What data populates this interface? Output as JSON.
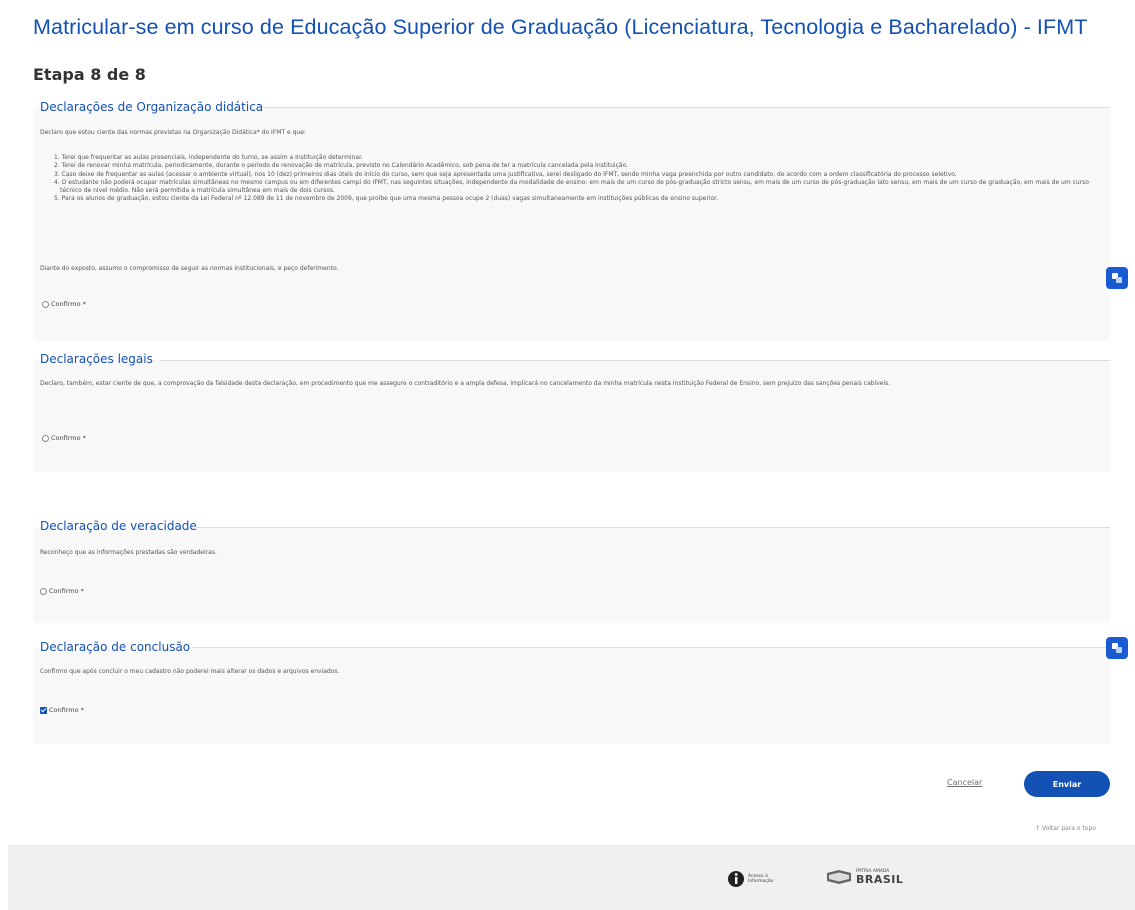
{
  "header": {
    "title": "Matricular-se em curso de Educação Superior de Graduação (Licenciatura, Tecnologia e Bacharelado) - IFMT",
    "step": "Etapa 8 de 8"
  },
  "sections": {
    "org": {
      "legend": "Declarações de Organização didática",
      "intro": "Declaro que estou ciente das normas previstas na Organização Didática* do IFMT e que:",
      "items": [
        "1. Terei que frequentar as aulas presenciais, independente do turno, se assim a Instituição determinar.",
        "2. Terei de renovar minha matrícula, periodicamente, durante o período de renovação de matrícula, previsto no Calendário Acadêmico, sob pena de ter a matrícula cancelada pela Instituição.",
        "3. Caso deixe de frequentar as aulas (acessar o ambiente virtual), nos 10 (dez) primeiros dias úteis do início do curso, sem que seja apresentada uma justificativa, serei desligado do IFMT, sendo minha vaga preenchida por outro candidato, de acordo com a ordem classificatória do processo seletivo.",
        "4. O estudante não poderá ocupar matrículas simultâneas no mesmo campus ou em diferentes campi do IFMT, nas seguintes situações, independente da modalidade de ensino: em mais de um curso de pós-graduação stricto sensu, em mais de um curso de pós-graduação lato sensu, em mais de um curso de graduação, em mais de um curso técnico de nível médio. Não será permitida a matrícula simultânea em mais de dois cursos.",
        "5. Para os alunos de graduação, estou ciente da Lei Federal nº 12.089 de 11 de novembro de 2009, que proíbe que uma mesma pessoa ocupe 2 (duas) vagas simultaneamente em instituições públicas de ensino superior."
      ],
      "closing": "Diante do exposto, assumo o compromisso de seguir as normas institucionais, e peço deferimento.",
      "confirm_label": "Confirmo *"
    },
    "legal": {
      "legend": "Declarações legais",
      "text": "Declaro, também, estar ciente de que, a comprovação da falsidade desta declaração, em procedimento que me assegure o contraditório e a ampla defesa, implicará no cancelamento da minha matrícula nesta Instituição Federal de Ensino, sem prejuízo das sanções penais cabíveis.",
      "confirm_label": "Confirmo *"
    },
    "truth": {
      "legend": "Declaração de veracidade",
      "text": "Reconheço que as informações prestadas são verdadeiras.",
      "confirm_label": "Confirmo *"
    },
    "conclusion": {
      "legend": "Declaração de conclusão",
      "text": "Confirmo que após concluir o meu cadastro não poderei mais alterar os dados e arquivos enviados.",
      "confirm_label": "Confirmo *",
      "confirmed": true
    }
  },
  "actions": {
    "cancel_label": "Cancelar",
    "submit_label": "Enviar",
    "back_to_top": "↑ Voltar para o topo"
  },
  "footer": {
    "access_logo_text": "Acesso à Informação",
    "brasil_top": "PÁTRIA AMADA",
    "brasil_main": "BRASIL"
  },
  "colors": {
    "primary": "#1351b4",
    "card_bg": "#f8f8f8",
    "footer_bg": "#f0f0f0"
  },
  "icons": {
    "side_button": "translate-icon",
    "access": "info-icon",
    "brasil": "flag-icon"
  }
}
